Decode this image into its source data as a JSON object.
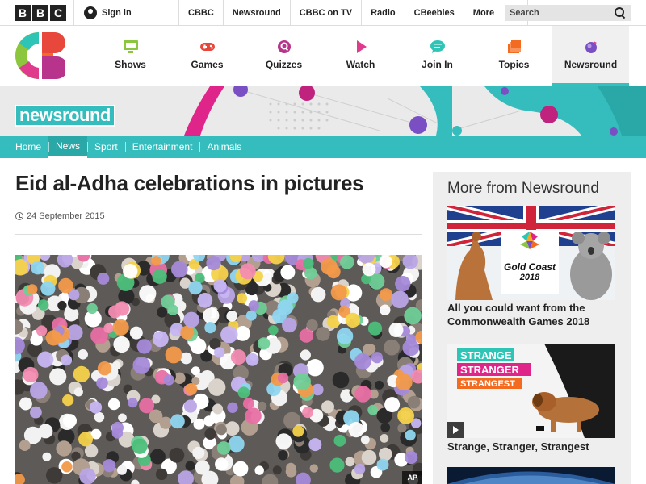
{
  "header": {
    "bbc_letters": [
      "B",
      "B",
      "C"
    ],
    "signin_label": "Sign in",
    "nav": [
      "CBBC",
      "Newsround",
      "CBBC on TV",
      "Radio",
      "CBeebies"
    ],
    "more_label": "More",
    "more_caret": "▾",
    "search_placeholder": "Search"
  },
  "cbbc_nav": [
    {
      "label": "Shows",
      "icon": "tv-icon",
      "color": "#8cc63f"
    },
    {
      "label": "Games",
      "icon": "gamepad-icon",
      "color": "#e8473b"
    },
    {
      "label": "Quizzes",
      "icon": "quiz-icon",
      "color": "#b8338c"
    },
    {
      "label": "Watch",
      "icon": "play-icon",
      "color": "#e03a8c"
    },
    {
      "label": "Join In",
      "icon": "chat-icon",
      "color": "#2ec4b6"
    },
    {
      "label": "Topics",
      "icon": "topics-icon",
      "color": "#f26b21"
    },
    {
      "label": "Newsround",
      "icon": "newsround-icon",
      "color": "#7b4fc4"
    }
  ],
  "banner": {
    "logo_text": "newsround"
  },
  "subnav": [
    "Home",
    "News",
    "Sport",
    "Entertainment",
    "Animals"
  ],
  "article": {
    "title": "Eid al-Adha celebrations in pictures",
    "date": "24 September 2015",
    "image_credit": "AP"
  },
  "sidebar": {
    "title": "More from Newsround",
    "cards": [
      {
        "caption": "All you could want from the Commonwealth Games 2018",
        "logo_line1": "Gold Coast",
        "logo_line2": "2018"
      },
      {
        "caption": "Strange, Stranger, Strangest",
        "tag1": "STRANGE",
        "tag2": "STRANGER",
        "tag3": "STRANGEST"
      }
    ]
  },
  "colors": {
    "teal": "#35bdbd",
    "active_tab_bg": "#f0f0f0",
    "sidebar_bg": "#eeeeee"
  }
}
